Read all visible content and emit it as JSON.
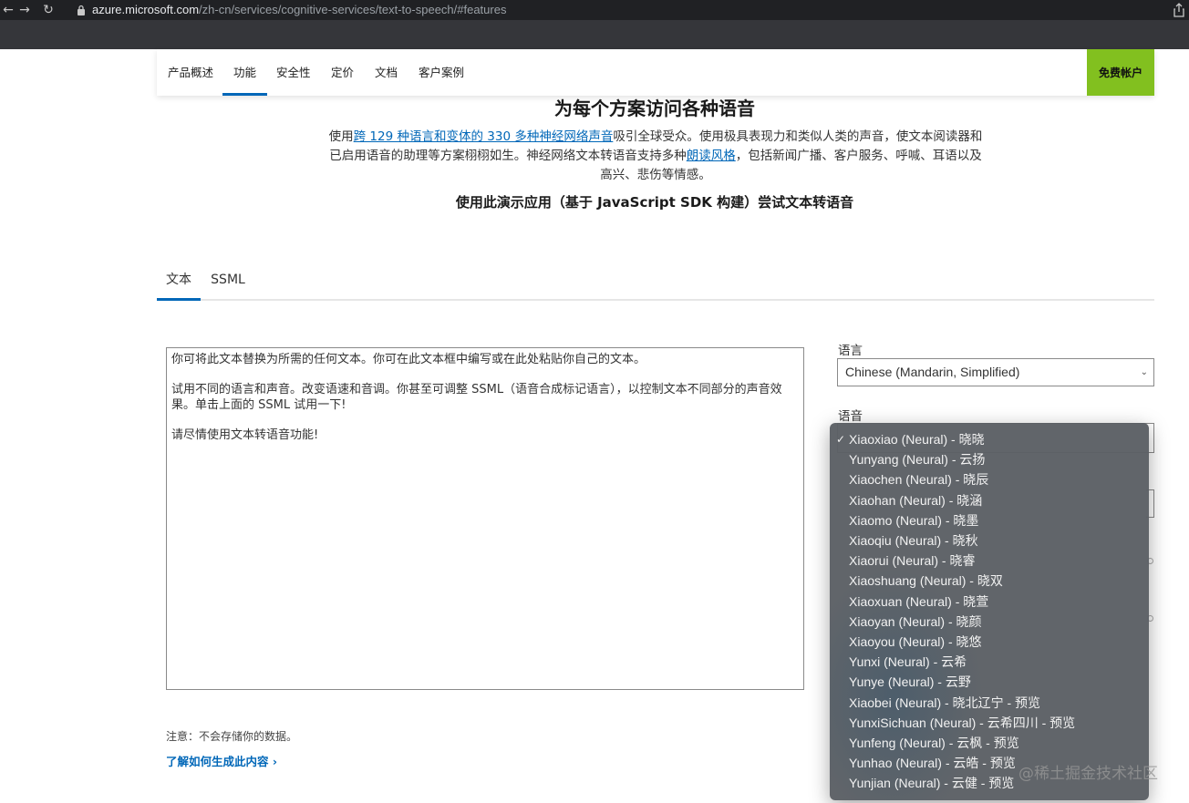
{
  "browser": {
    "url_host": "azure.microsoft.com",
    "url_path": "/zh-cn/services/cognitive-services/text-to-speech/#features"
  },
  "subnav": {
    "items": [
      {
        "label": "产品概述"
      },
      {
        "label": "功能"
      },
      {
        "label": "安全性"
      },
      {
        "label": "定价"
      },
      {
        "label": "文档"
      },
      {
        "label": "客户案例"
      }
    ],
    "active": "功能",
    "cta_label": "免费帐户"
  },
  "heading": "为每个方案访问各种语音",
  "intro": {
    "before_link1": "使用",
    "link1": "跨 129 种语言和变体的 330 多种神经网络声音",
    "middle": "吸引全球受众。使用极具表现力和类似人类的声音，使文本阅读器和已启用语音的助理等方案栩栩如生。神经网络文本转语音支持多种",
    "link2": "朗读风格",
    "after_link2": "，包括新闻广播、客户服务、呼喊、耳语以及高兴、悲伤等情感。"
  },
  "demo_title": "使用此演示应用（基于 JavaScript SDK 构建）尝试文本转语音",
  "tabs": [
    {
      "label": "文本"
    },
    {
      "label": "SSML"
    }
  ],
  "textarea_value": "你可将此文本替换为所需的任何文本。你可在此文本框中编写或在此处粘贴你自己的文本。\n\n试用不同的语言和声音。改变语速和音调。你甚至可调整 SSML（语音合成标记语言），以控制文本不同部分的声音效果。单击上面的 SSML 试用一下!\n\n请尽情使用文本转语音功能!",
  "note": "注意：不会存储你的数据。",
  "learn_link": "了解如何生成此内容",
  "language": {
    "label": "语言",
    "value": "Chinese (Mandarin, Simplified)"
  },
  "voice": {
    "label": "语音",
    "options": [
      "Xiaoxiao (Neural) - 晓晓",
      "Yunyang (Neural) - 云扬",
      "Xiaochen (Neural) - 晓辰",
      "Xiaohan (Neural) - 晓涵",
      "Xiaomo (Neural) - 晓墨",
      "Xiaoqiu (Neural) - 晓秋",
      "Xiaorui (Neural) - 晓睿",
      "Xiaoshuang (Neural) - 晓双",
      "Xiaoxuan (Neural) - 晓萱",
      "Xiaoyan (Neural) - 晓颜",
      "Xiaoyou (Neural) - 晓悠",
      "Yunxi (Neural) - 云希",
      "Yunye (Neural) - 云野",
      "Xiaobei (Neural) - 晓北辽宁 - 预览",
      "YunxiSichuan (Neural) - 云希四川 - 预览",
      "Yunfeng (Neural) - 云枫 - 预览",
      "Yunhao (Neural) - 云皓 - 预览",
      "Yunjian (Neural) - 云健 - 预览"
    ],
    "selected_index": 0
  },
  "watermark": "@稀土掘金技术社区",
  "colors": {
    "accent": "#0067b8",
    "cta": "#82c01f",
    "dropdown_bg": "#5c6065"
  }
}
